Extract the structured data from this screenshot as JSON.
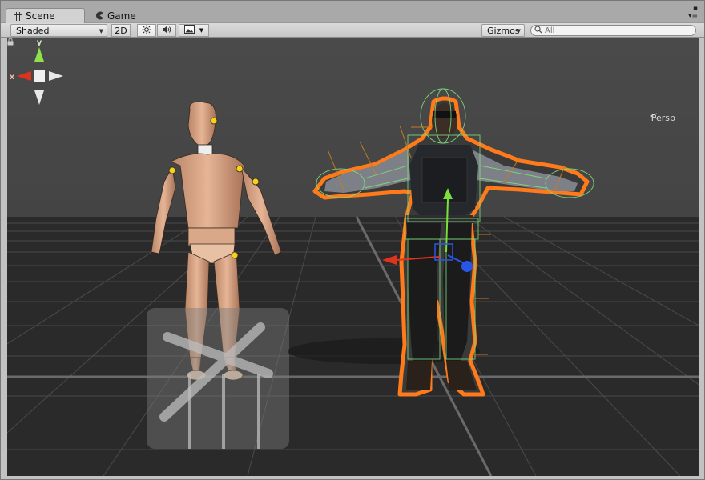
{
  "tabs": [
    {
      "label": "Scene",
      "icon": "grid-icon",
      "active": true
    },
    {
      "label": "Game",
      "icon": "pacman-icon",
      "active": false
    }
  ],
  "toolbar": {
    "shading_mode": "Shaded",
    "mode_2d": "2D",
    "gizmos_label": "Gizmos",
    "search_placeholder": "All"
  },
  "viewport": {
    "projection_label": "Persp",
    "axis_labels": {
      "x": "x",
      "y": "y"
    },
    "background_color": "#474747",
    "grid_color": "#595959",
    "selection_outline_color": "#ff7a1a",
    "collider_color": "#7fe07f"
  }
}
